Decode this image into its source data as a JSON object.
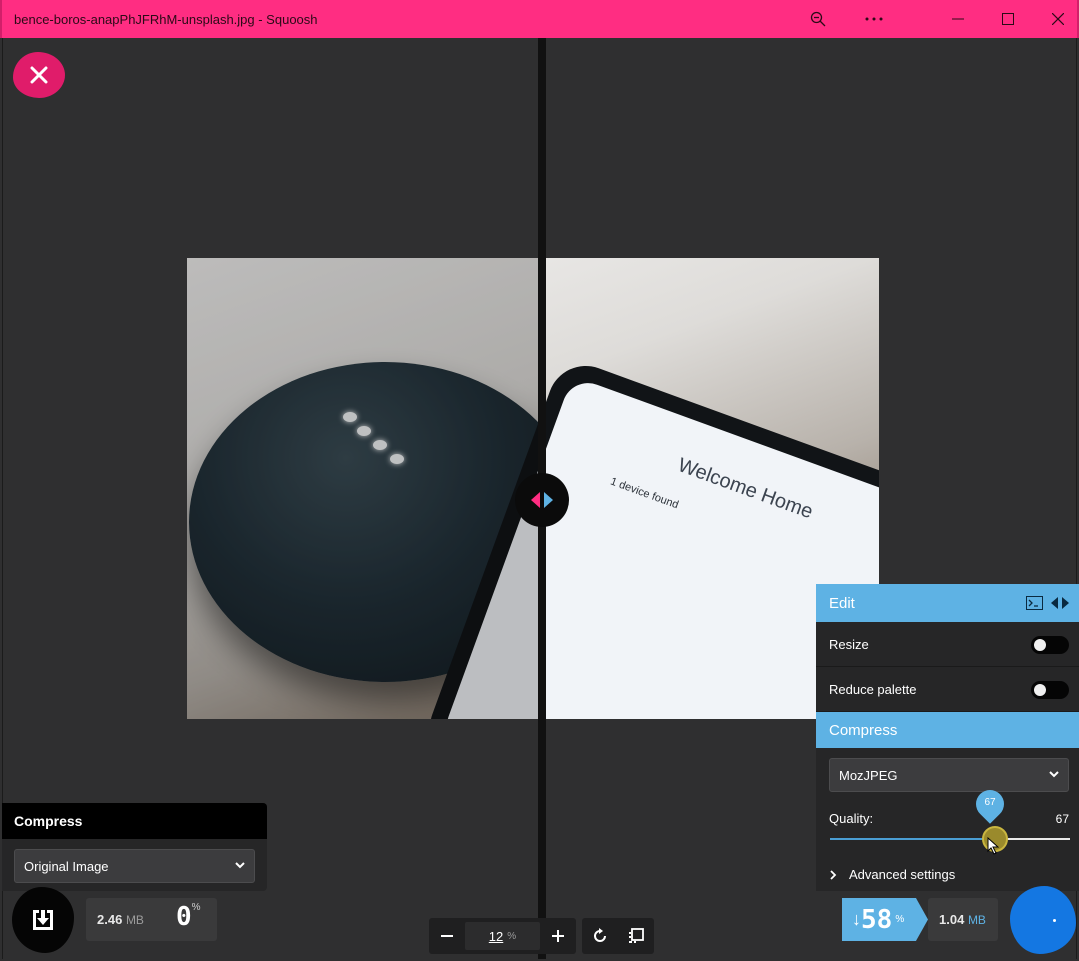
{
  "window": {
    "title": "bence-boros-anapPhJFRhM-unsplash.jpg - Squoosh",
    "controls": [
      "zoom-icon",
      "more-icon",
      "minimize-icon",
      "maximize-icon",
      "close-icon"
    ]
  },
  "colors": {
    "titlebar": "#ff2d82",
    "accent_blue": "#5eb2e4",
    "accent_pink": "#e01c6a",
    "download_blue": "#1477e2"
  },
  "image_text": {
    "welcome": "Welcome Home",
    "found": "1 device found"
  },
  "left": {
    "compress_header": "Compress",
    "selected_option": "Original Image",
    "size_value": "2.46",
    "size_unit": "MB",
    "percent": "0",
    "percent_unit": "%"
  },
  "zoom": {
    "minus": "−",
    "value": "12",
    "unit": "%",
    "plus": "+"
  },
  "right": {
    "edit_header": "Edit",
    "resize_label": "Resize",
    "resize_on": false,
    "reduce_palette_label": "Reduce palette",
    "reduce_palette_on": false,
    "compress_header": "Compress",
    "codec": "MozJPEG",
    "quality_label": "Quality:",
    "quality_value": "67",
    "quality_pin": "67",
    "quality_fraction": 0.67,
    "advanced_label": "Advanced settings",
    "savings_arrow": "↓",
    "savings_value": "58",
    "savings_unit": "%",
    "size_value": "1.04",
    "size_unit": "MB"
  }
}
